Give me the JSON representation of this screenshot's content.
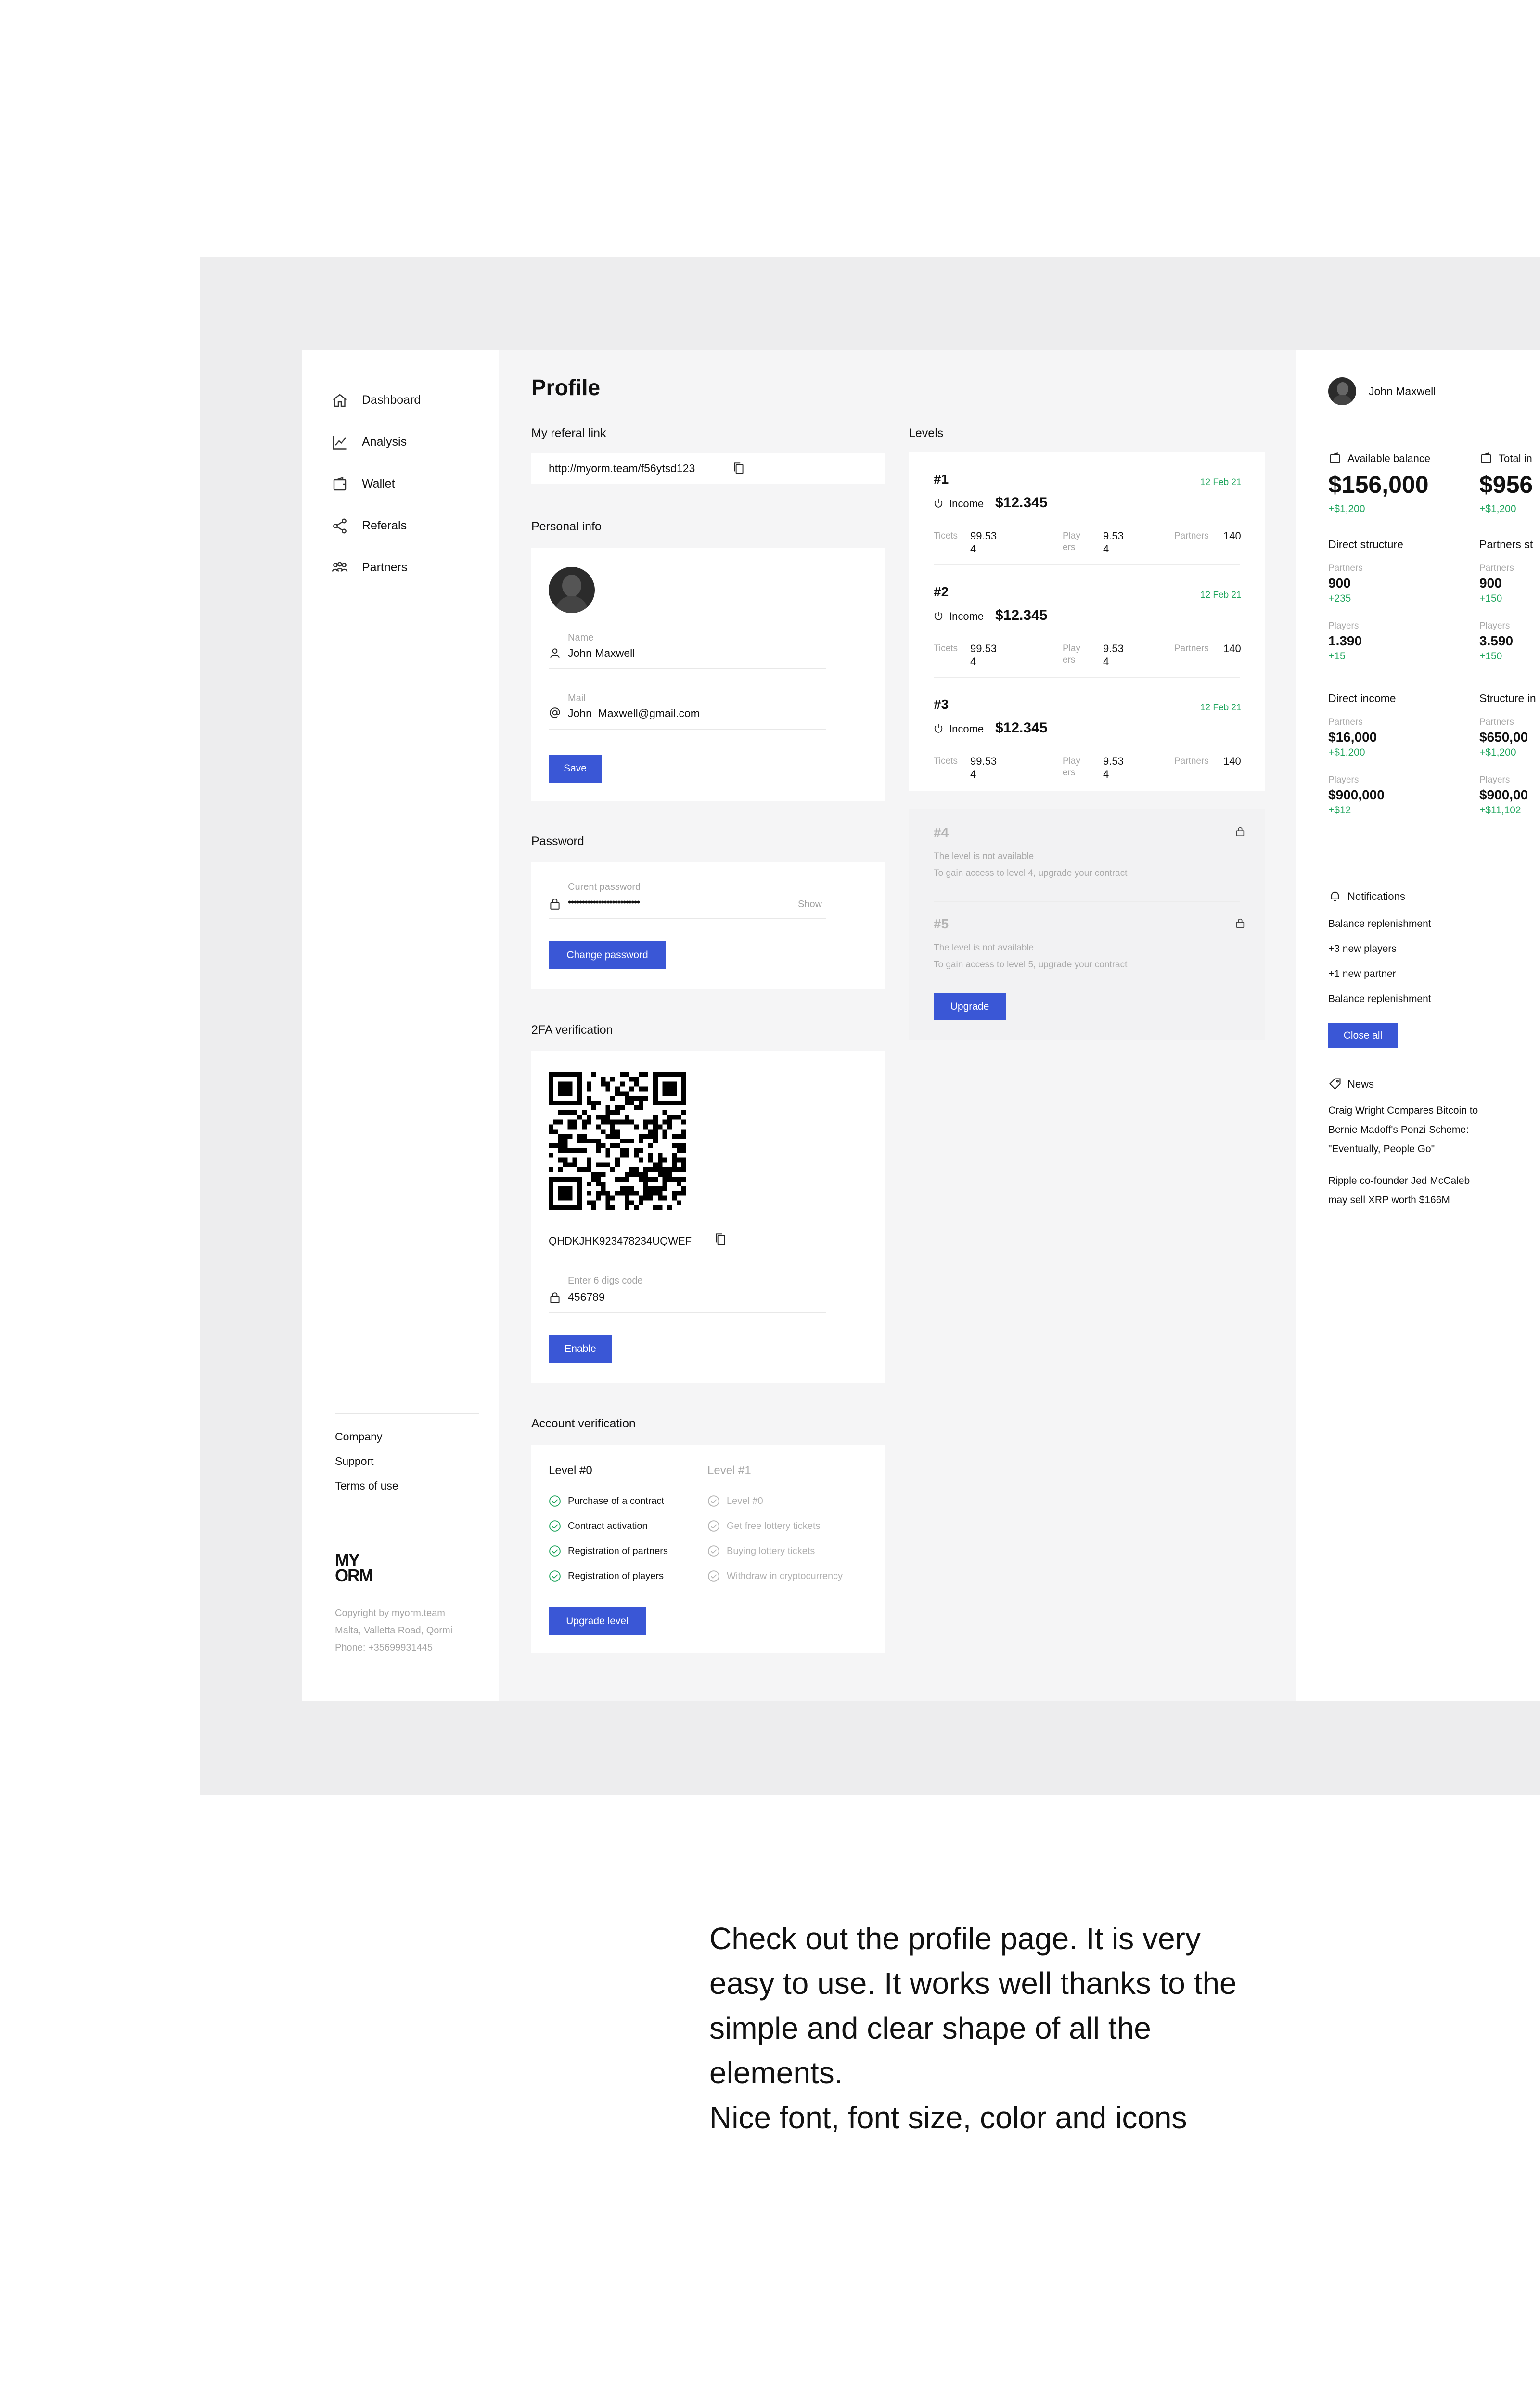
{
  "sidebar": {
    "nav": [
      {
        "label": "Dashboard",
        "icon": "home-icon"
      },
      {
        "label": "Analysis",
        "icon": "chart-icon"
      },
      {
        "label": "Wallet",
        "icon": "wallet-icon"
      },
      {
        "label": "Referals",
        "icon": "share-icon"
      },
      {
        "label": "Partners",
        "icon": "users-icon"
      }
    ],
    "links": [
      "Company",
      "Support",
      "Terms of use"
    ],
    "logo_line1": "MY",
    "logo_line2": "ORM",
    "copyright": [
      "Copyright by myorm.team",
      "Malta, Valletta Road, Qormi",
      "Phone: +35699931445"
    ]
  },
  "profile": {
    "title": "Profile",
    "referal_label": "My referal link",
    "referal_link": "http://myorm.team/f56ytsd123",
    "personal_label": "Personal info",
    "name_label": "Name",
    "name_value": "John Maxwell",
    "mail_label": "Mail",
    "mail_value": "John_Maxwell@gmail.com",
    "save_label": "Save",
    "password_label": "Password",
    "current_password_label": "Curent password",
    "password_value": "••••••••••••••••••••••••••",
    "show_label": "Show",
    "change_password_label": "Change password",
    "twofa_label": "2FA verification",
    "twofa_code": "QHDKJHK923478234UQWEF",
    "code_label": "Enter 6 digs code",
    "code_value": "456789",
    "enable_label": "Enable",
    "account_label": "Account verification",
    "level0_title": "Level #0",
    "level1_title": "Level #1",
    "level0_items": [
      "Purchase of a contract",
      "Contract activation",
      "Registration of partners",
      "Registration of players"
    ],
    "level1_items": [
      "Level #0",
      "Get free lottery tickets",
      "Buying lottery tickets",
      "Withdraw in cryptocurrency"
    ],
    "upgrade_level_label": "Upgrade level"
  },
  "levels": {
    "label": "Levels",
    "items": [
      {
        "num": "#1",
        "date": "12 Feb 21",
        "income_label": "Income",
        "income": "$12.345",
        "tickets_label": "Ticets",
        "tickets": "99.534",
        "players_label": "Players",
        "players": "9.534",
        "partners_label": "Partners",
        "partners": "140"
      },
      {
        "num": "#2",
        "date": "12 Feb 21",
        "income_label": "Income",
        "income": "$12.345",
        "tickets_label": "Ticets",
        "tickets": "99.534",
        "players_label": "Players",
        "players": "9.534",
        "partners_label": "Partners",
        "partners": "140"
      },
      {
        "num": "#3",
        "date": "12 Feb 21",
        "income_label": "Income",
        "income": "$12.345",
        "tickets_label": "Ticets",
        "tickets": "99.534",
        "players_label": "Players",
        "players": "9.534",
        "partners_label": "Partners",
        "partners": "140"
      }
    ],
    "locked": [
      {
        "num": "#4",
        "line1": "The level is not available",
        "line2": "To gain access to level 4, upgrade your contract"
      },
      {
        "num": "#5",
        "line1": "The level is not available",
        "line2": "To gain access to level 5, upgrade your contract"
      }
    ],
    "upgrade_label": "Upgrade"
  },
  "right": {
    "user_name": "John Maxwell",
    "available_label": "Available balance",
    "available_value": "$156,000",
    "available_delta": "+$1,200",
    "total_label": "Total in",
    "total_value": "$956",
    "total_delta": "+$1,200",
    "direct_structure": "Direct structure",
    "partners_structure": "Partners st",
    "partners_label": "Partners",
    "players_label": "Players",
    "ds_partners": "900",
    "ds_partners_delta": "+235",
    "ds_players": "1.390",
    "ds_players_delta": "+15",
    "ps_partners": "900",
    "ps_partners_delta": "+150",
    "ps_players": "3.590",
    "ps_players_delta": "+150",
    "direct_income": "Direct income",
    "structure_income": "Structure in",
    "di_partners": "$16,000",
    "di_partners_delta": "+$1,200",
    "di_players": "$900,000",
    "di_players_delta": "+$12",
    "si_partners": "$650,00",
    "si_partners_delta": "+$1,200",
    "si_players": "$900,00",
    "si_players_delta": "+$11,102",
    "notifications_label": "Notifications",
    "notifications": [
      "Balance replenishment",
      "+3 new players",
      "+1 new partner",
      "Balance replenishment"
    ],
    "close_all_label": "Close all",
    "news_label": "News",
    "news1": [
      "Craig Wright Compares Bitcoin to",
      "Bernie Madoff's Ponzi Scheme:",
      "\"Eventually, People Go\""
    ],
    "news2": [
      "Ripple co-founder Jed McCaleb",
      "may sell XRP worth $166M"
    ]
  },
  "caption": {
    "lines": [
      "Check out the profile page. It is very",
      "easy to use. It works well thanks to the",
      "simple and clear shape of all the",
      "elements.",
      "Nice font, font size, color and icons"
    ]
  },
  "colors": {
    "accent": "#3a57d6",
    "green": "#1fa55d",
    "frame": "#ededee",
    "main_bg": "#f5f5f6"
  }
}
